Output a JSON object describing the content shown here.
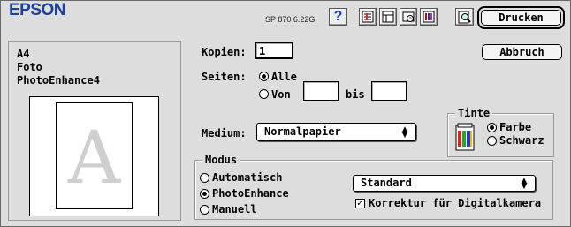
{
  "header": {
    "brand": "EPSON",
    "model_version": "SP 870 6.22G",
    "icons": [
      "help-icon",
      "utility-icon",
      "layout-icon",
      "printer-status-icon",
      "ink-levels-icon",
      "preview-icon"
    ]
  },
  "buttons": {
    "print": "Drucken",
    "cancel": "Abbruch"
  },
  "summary": {
    "paper_size": "A4",
    "media": "Foto",
    "mode": "PhotoEnhance4"
  },
  "preview": {
    "glyph": "A"
  },
  "copies": {
    "label": "Kopien:",
    "value": "1"
  },
  "pages": {
    "label": "Seiten:",
    "all_label": "Alle",
    "from_label": "Von",
    "to_label": "bis",
    "from_value": "",
    "to_value": "",
    "selected": "Alle"
  },
  "ink": {
    "title": "Tinte",
    "color_label": "Farbe",
    "black_label": "Schwarz",
    "selected": "Farbe"
  },
  "medium": {
    "label": "Medium:",
    "value": "Normalpapier"
  },
  "modus": {
    "title": "Modus",
    "options": [
      "Automatisch",
      "PhotoEnhance",
      "Manuell"
    ],
    "selected": "PhotoEnhance",
    "preset": "Standard",
    "camera_checkbox_label": "Korrektur für Digitalkamera",
    "camera_checked": true
  },
  "colors": {
    "brand": "#1f3f9f",
    "dialog_bg": "#dddddd"
  }
}
